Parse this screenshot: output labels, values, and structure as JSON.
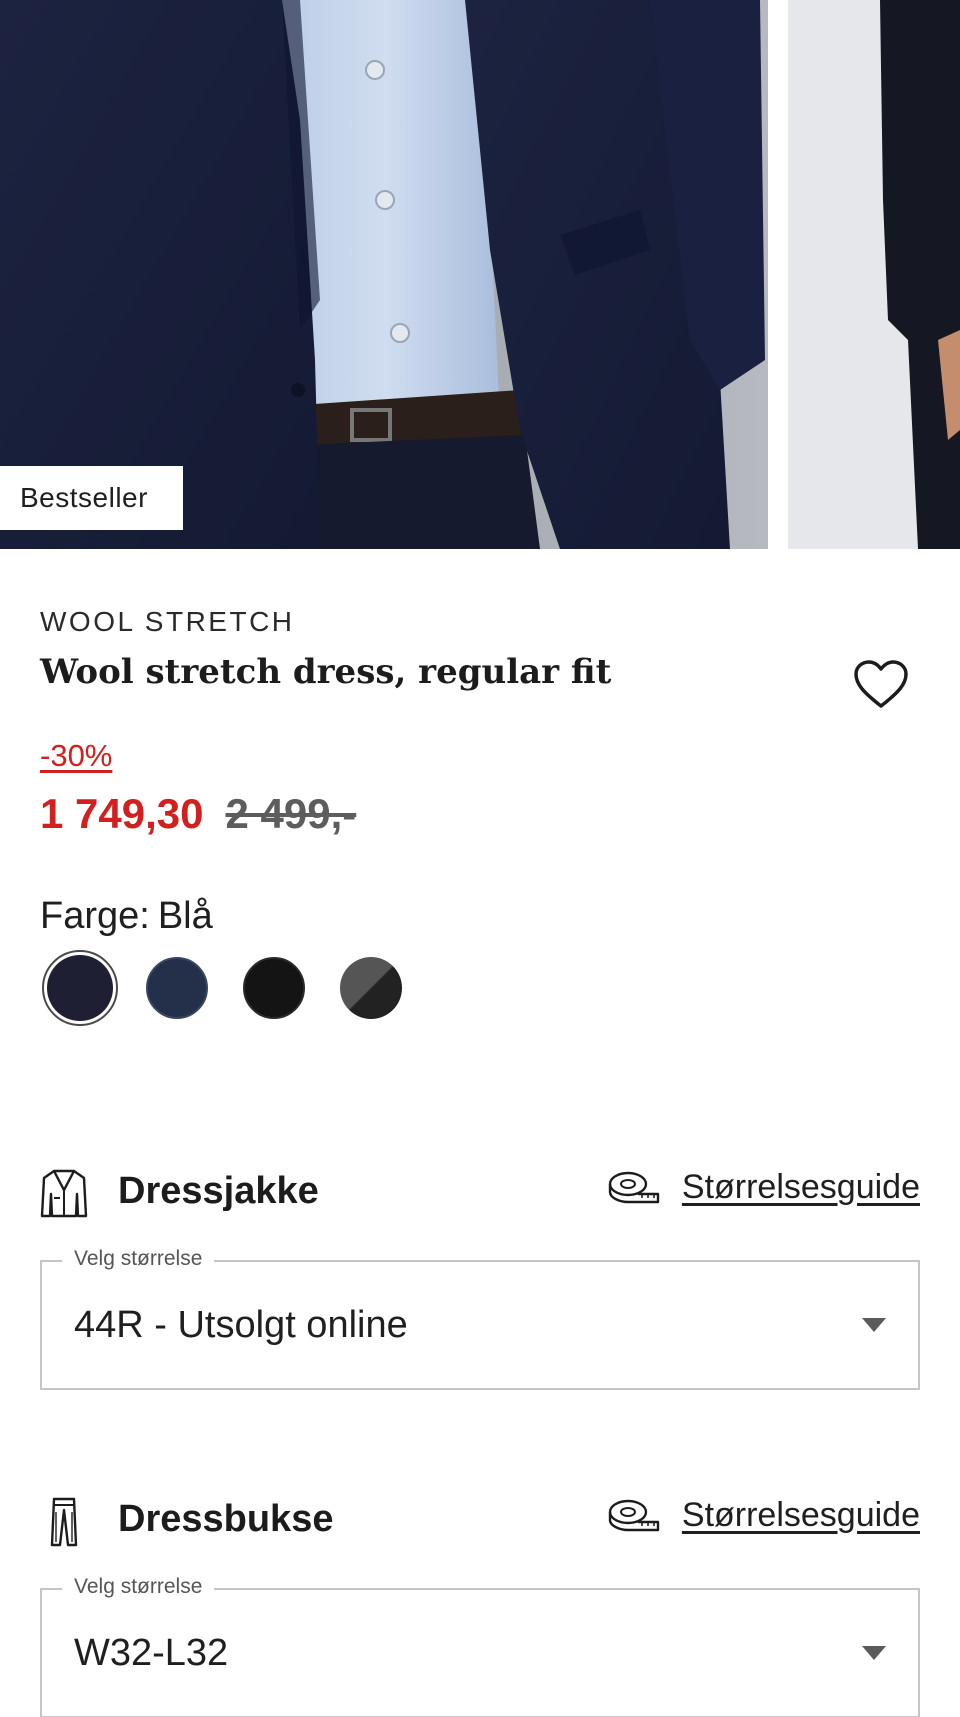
{
  "gallery": {
    "badge": "Bestseller"
  },
  "product": {
    "brand": "WOOL STRETCH",
    "title": "Wool stretch dress, regular fit",
    "discount": "-30%",
    "price_now": "1 749,30",
    "price_old": "2 499,-"
  },
  "color": {
    "label": "Farge:",
    "selected": "Blå",
    "swatches": [
      {
        "name": "navy-dark",
        "color": "#1e1f33",
        "selected": true
      },
      {
        "name": "navy",
        "color": "#24304a",
        "selected": false
      },
      {
        "name": "black",
        "color": "#141414",
        "selected": false
      },
      {
        "name": "grey-black",
        "color": "#3a3a3a",
        "selected": false
      }
    ]
  },
  "sizes": [
    {
      "garment": "Dressjakke",
      "guide_label": "Størrelsesguide",
      "legend": "Velg størrelse",
      "value": "44R - Utsolgt online"
    },
    {
      "garment": "Dressbukse",
      "guide_label": "Størrelsesguide",
      "legend": "Velg størrelse",
      "value": "W32-L32"
    }
  ],
  "icons": {
    "favorite": "heart-icon",
    "jacket": "jacket-icon",
    "trousers": "trousers-icon",
    "size_guide": "tape-measure-icon",
    "dropdown": "caret-down-icon"
  },
  "colors": {
    "sale_red": "#d0201f",
    "old_price_grey": "#5d5d5d",
    "border_grey": "#c6c6c6"
  }
}
